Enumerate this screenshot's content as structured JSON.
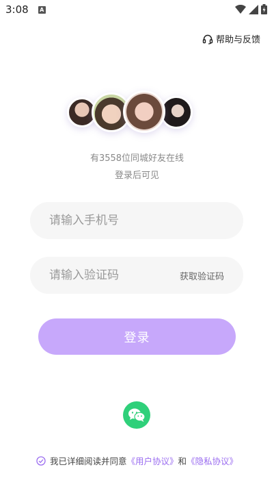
{
  "status": {
    "time": "3:08",
    "notif_badge": "A"
  },
  "header": {
    "help_label": "帮助与反馈",
    "help_icon": "headset-icon"
  },
  "hero": {
    "online_text": "有3558位同城好友在线",
    "subtitle": "登录后可见"
  },
  "form": {
    "phone_placeholder": "请输入手机号",
    "phone_value": "",
    "code_placeholder": "请输入验证码",
    "code_value": "",
    "get_code_label": "获取验证码",
    "login_label": "登录"
  },
  "third_party": {
    "wechat_icon": "wechat-icon"
  },
  "agreement": {
    "prefix": "我已详细阅读并同意",
    "user_agreement": "《用户协议》",
    "conj": "和",
    "privacy_policy": "《隐私协议》",
    "check_icon": "check-circle-icon"
  },
  "colors": {
    "accent": "#c7a8fb",
    "link": "#9a6cf0",
    "wechat": "#2fd07a",
    "field_bg": "#f6f6f6"
  }
}
